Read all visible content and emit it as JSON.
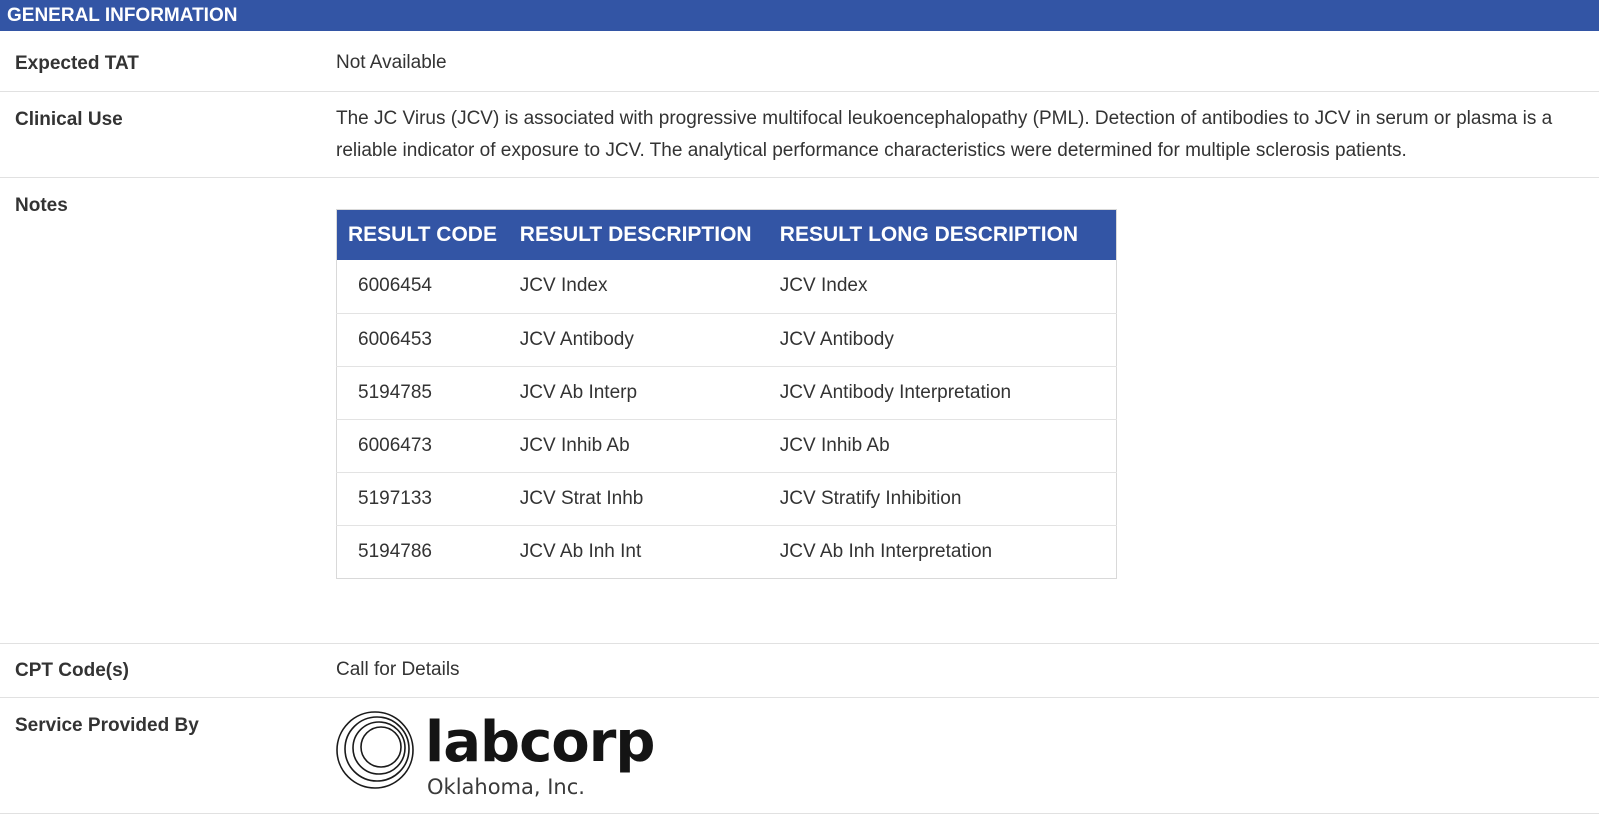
{
  "section": {
    "title": "GENERAL INFORMATION"
  },
  "rows": {
    "tat": {
      "label": "Expected TAT",
      "value": "Not Available"
    },
    "clinical": {
      "label": "Clinical Use",
      "value": "The JC Virus (JCV) is associated with progressive multifocal leukoencephalopathy (PML). Detection of antibodies to JCV in serum or plasma is a reliable indicator of exposure to JCV. The analytical performance characteristics were determined for multiple sclerosis patients."
    },
    "notes": {
      "label": "Notes"
    },
    "cpt": {
      "label": "CPT Code(s)",
      "value": "Call for Details"
    },
    "service": {
      "label": "Service Provided By"
    }
  },
  "results_table": {
    "headers": [
      "RESULT CODE",
      "RESULT DESCRIPTION",
      "RESULT LONG DESCRIPTION"
    ],
    "rows": [
      [
        "6006454",
        "JCV Index",
        "JCV Index"
      ],
      [
        "6006453",
        "JCV Antibody",
        "JCV Antibody"
      ],
      [
        "5194785",
        "JCV Ab Interp",
        "JCV Antibody Interpretation"
      ],
      [
        "6006473",
        "JCV Inhib Ab",
        "JCV Inhib Ab"
      ],
      [
        "5197133",
        "JCV Strat Inhb",
        "JCV Stratify Inhibition"
      ],
      [
        "5194786",
        "JCV Ab Inh Int",
        "JCV Ab Inh Interpretation"
      ]
    ]
  },
  "logo": {
    "name": "labcorp",
    "subtitle": "Oklahoma, Inc.",
    "icon": "concentric-circles-logo"
  },
  "colors": {
    "header_blue": "#3355a5",
    "text": "#333333",
    "divider": "#e1e1e1"
  }
}
